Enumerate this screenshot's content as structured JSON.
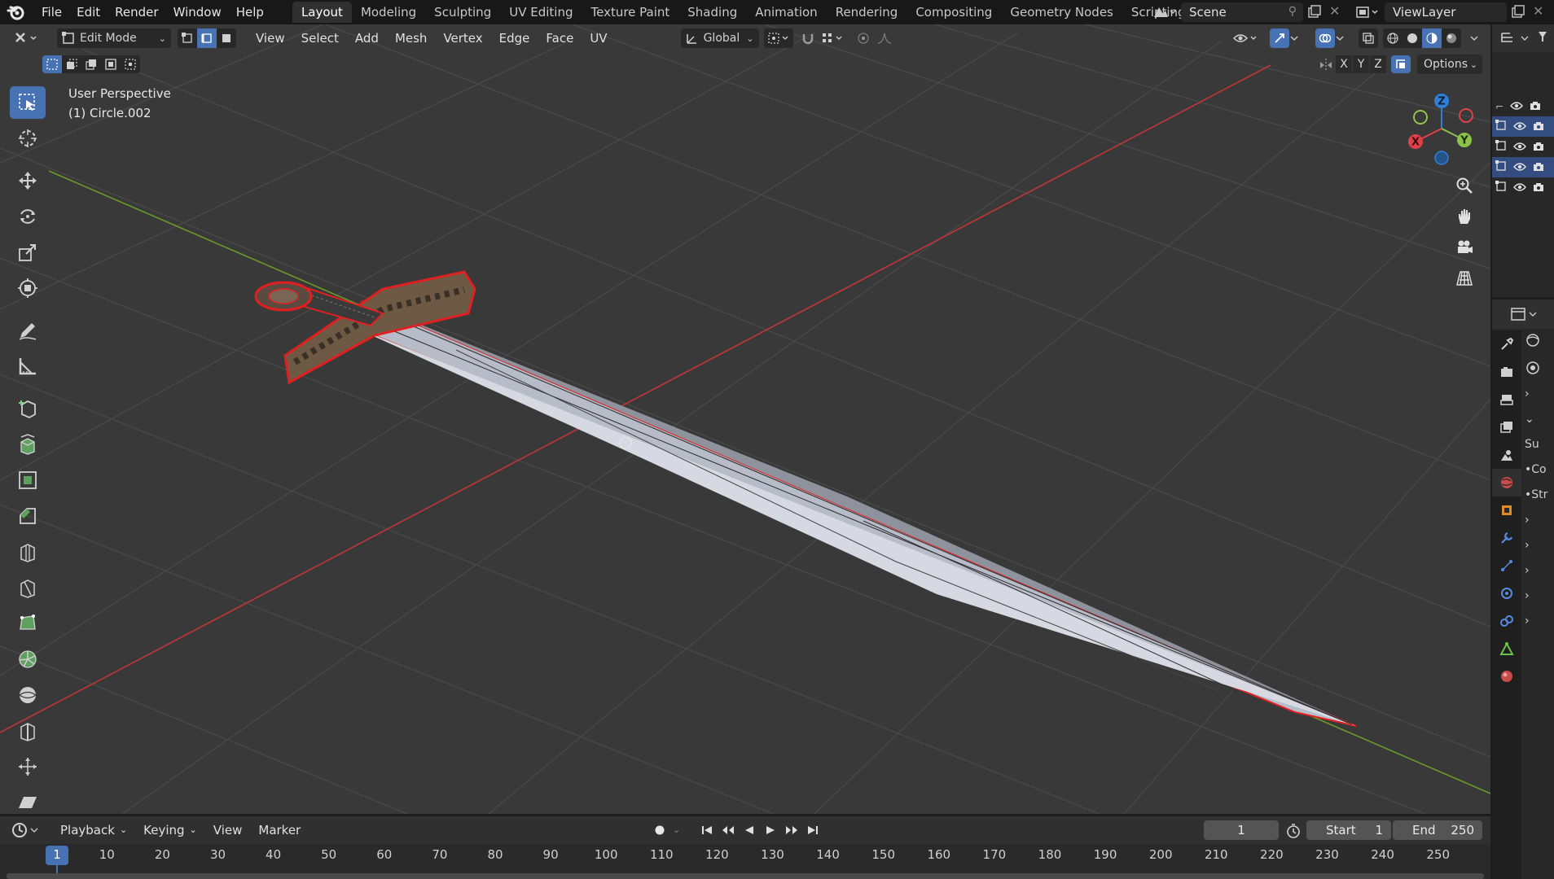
{
  "topbar": {
    "menus": [
      "File",
      "Edit",
      "Render",
      "Window",
      "Help"
    ],
    "workspaces": [
      "Layout",
      "Modeling",
      "Sculpting",
      "UV Editing",
      "Texture Paint",
      "Shading",
      "Animation",
      "Rendering",
      "Compositing",
      "Geometry Nodes",
      "Scripting"
    ],
    "active_workspace": "Layout",
    "scene": "Scene",
    "view_layer": "ViewLayer"
  },
  "viewport_header": {
    "mode": "Edit Mode",
    "menus": [
      "View",
      "Select",
      "Add",
      "Mesh",
      "Vertex",
      "Edge",
      "Face",
      "UV"
    ],
    "transform_orientation": "Global",
    "options_label": "Options",
    "axes": [
      "X",
      "Y",
      "Z"
    ]
  },
  "viewport_overlay": {
    "perspective": "User Perspective",
    "object": "(1) Circle.002"
  },
  "gizmo": {
    "z": "Z",
    "y": "Y",
    "x": "X"
  },
  "properties": {
    "labels": [
      "Su",
      "•Co",
      "•Str"
    ]
  },
  "timeline": {
    "menus": [
      "Playback",
      "Keying",
      "View",
      "Marker"
    ],
    "current_frame": "1",
    "start_label": "Start",
    "start": "1",
    "end_label": "End",
    "end": "250",
    "ticks": [
      "1",
      "10",
      "20",
      "30",
      "40",
      "50",
      "60",
      "70",
      "80",
      "90",
      "100",
      "110",
      "120",
      "130",
      "140",
      "150",
      "160",
      "170",
      "180",
      "190",
      "200",
      "210",
      "220",
      "230",
      "240",
      "250"
    ]
  },
  "colors": {
    "accent": "#4772b3",
    "viewport_bg": "#393939",
    "x_axis": "#c0353a",
    "y_axis": "#6a9a2a",
    "selection_outline": "#e02020"
  }
}
